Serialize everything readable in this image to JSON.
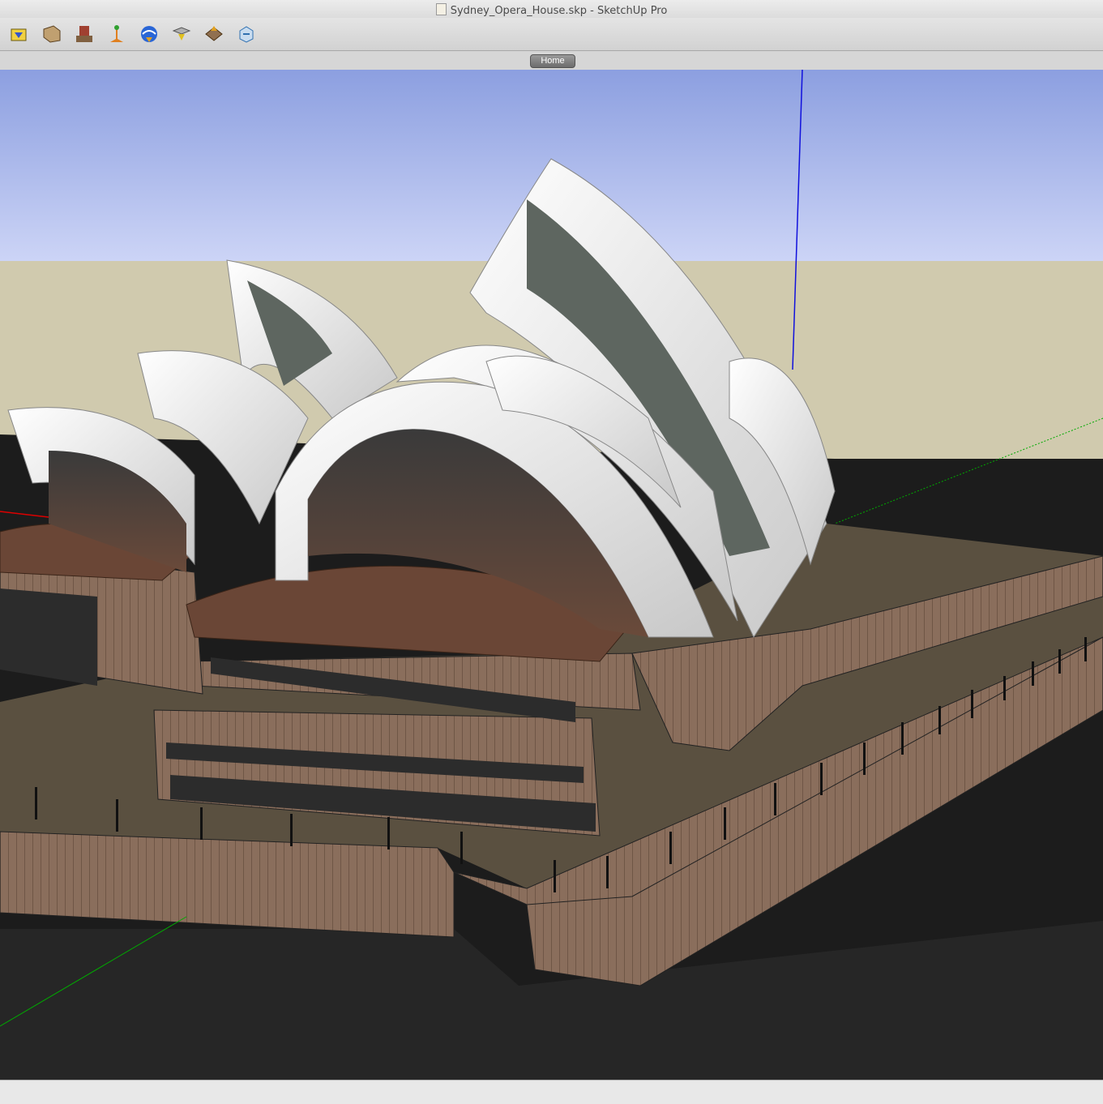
{
  "window": {
    "title": "Sydney_Opera_House.skp - SketchUp Pro"
  },
  "toolbar": {
    "items": [
      {
        "icon": "get-models-icon"
      },
      {
        "icon": "share-model-icon"
      },
      {
        "icon": "share-component-icon"
      },
      {
        "icon": "get-current-view-icon"
      },
      {
        "icon": "toggle-terrain-icon"
      },
      {
        "icon": "add-location-icon"
      },
      {
        "icon": "preview-google-earth-icon"
      },
      {
        "icon": "photo-textures-icon"
      }
    ]
  },
  "scenes": {
    "tabs": [
      {
        "label": "Home"
      }
    ]
  },
  "colors": {
    "sky_top": "#8c9fe0",
    "sky_bottom": "#ccd4f6",
    "ground": "#d0caae",
    "water": "#1c1c1c",
    "podium": "#8a6e5c",
    "plaza": "#5a5040",
    "shell": "#f4f4f4",
    "blue_axis": "#1010dd",
    "red_axis": "#dd0000",
    "green_axis": "#00aa00"
  }
}
